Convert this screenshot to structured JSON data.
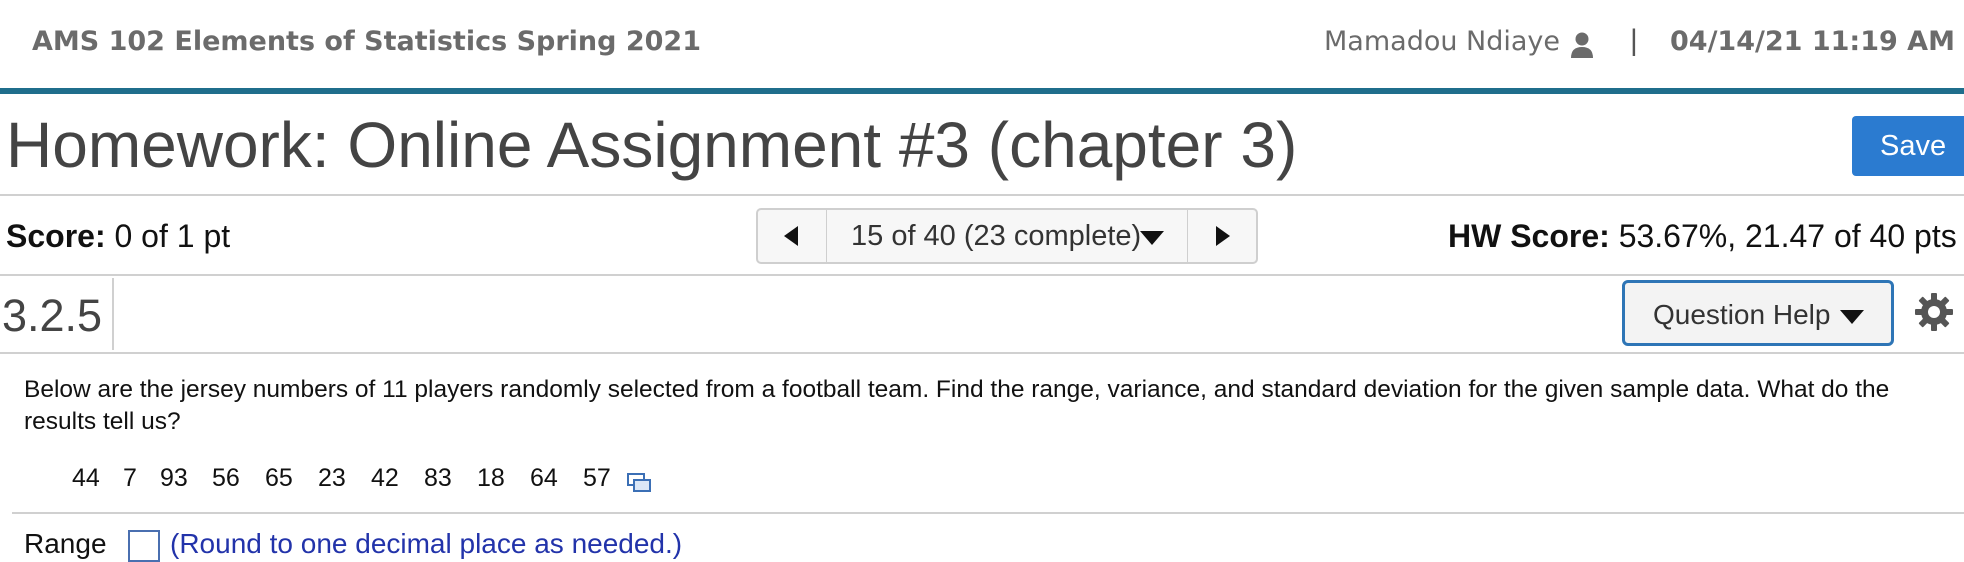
{
  "header": {
    "course": "AMS 102 Elements of Statistics Spring 2021",
    "user": "Mamadou Ndiaye",
    "separator": "|",
    "datetime": "04/14/21 11:19 AM"
  },
  "assignment": {
    "title": "Homework: Online Assignment #3 (chapter 3)",
    "save_label": "Save"
  },
  "status": {
    "score_label": "Score:",
    "score_value": "0 of 1 pt",
    "pager_text": "15 of 40 (23 complete)",
    "hw_score_label": "HW Score:",
    "hw_score_value": "53.67%, 21.47 of 40 pts"
  },
  "question": {
    "number": "3.2.5",
    "help_label": "Question Help",
    "text": "Below are the jersey numbers of 11 players randomly selected from a football team. Find the range, variance, and standard deviation for the given sample data. What do the results tell us?",
    "data": [
      "44",
      "7",
      "93",
      "56",
      "65",
      "23",
      "42",
      "83",
      "18",
      "64",
      "57"
    ],
    "range_label": "Range",
    "range_hint": "(Round to one decimal place as needed.)"
  },
  "icons": {
    "user": "user-icon",
    "prev": "triangle-left-icon",
    "next": "triangle-right-icon",
    "dropdown": "caret-down-icon",
    "settings": "gear-icon",
    "copy": "copy-data-icon"
  },
  "colors": {
    "accent_bar": "#1f6e8c",
    "save_button": "#2b7bd0",
    "help_border": "#2e75b6"
  }
}
